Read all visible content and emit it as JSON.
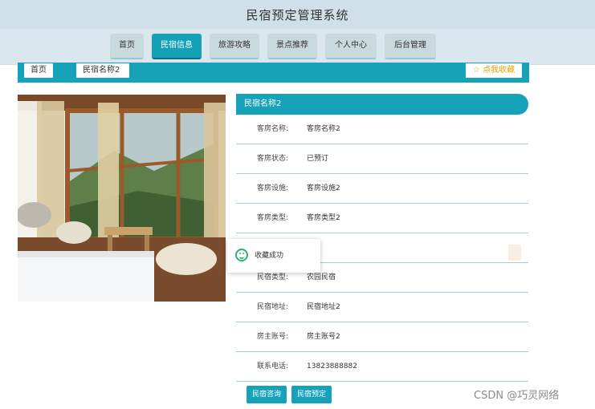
{
  "header": {
    "title": "民宿预定管理系统"
  },
  "nav": {
    "items": [
      "首页",
      "民宿信息",
      "旅游攻略",
      "景点推荐",
      "个人中心",
      "后台管理"
    ],
    "active": "民宿信息"
  },
  "breadcrumb": {
    "home": "首页",
    "current": "民宿名称2"
  },
  "favorite_button": {
    "label": "☆ 点我收藏"
  },
  "info": {
    "title": "民宿名称2",
    "rows": [
      {
        "label": "客房名称:",
        "value": "客房名称2"
      },
      {
        "label": "客房状态:",
        "value": "已预订"
      },
      {
        "label": "客房设施:",
        "value": "客房设施2"
      },
      {
        "label": "客房类型:",
        "value": "客房类型2"
      },
      {
        "label": "",
        "value": ""
      },
      {
        "label": "民宿类型:",
        "value": "农园民宿"
      },
      {
        "label": "民宿地址:",
        "value": "民宿地址2"
      },
      {
        "label": "房主账号:",
        "value": "房主账号2"
      },
      {
        "label": "联系电话:",
        "value": "13823888882"
      }
    ]
  },
  "toast": {
    "message": "收藏成功"
  },
  "actions": {
    "consult": "民宿咨询",
    "book": "民宿预定"
  },
  "watermark": "CSDN @巧灵网络",
  "colors": {
    "accent": "#16a2b8",
    "header_bg": "#cfe0e8",
    "nav_bg": "#dbe7ee"
  }
}
